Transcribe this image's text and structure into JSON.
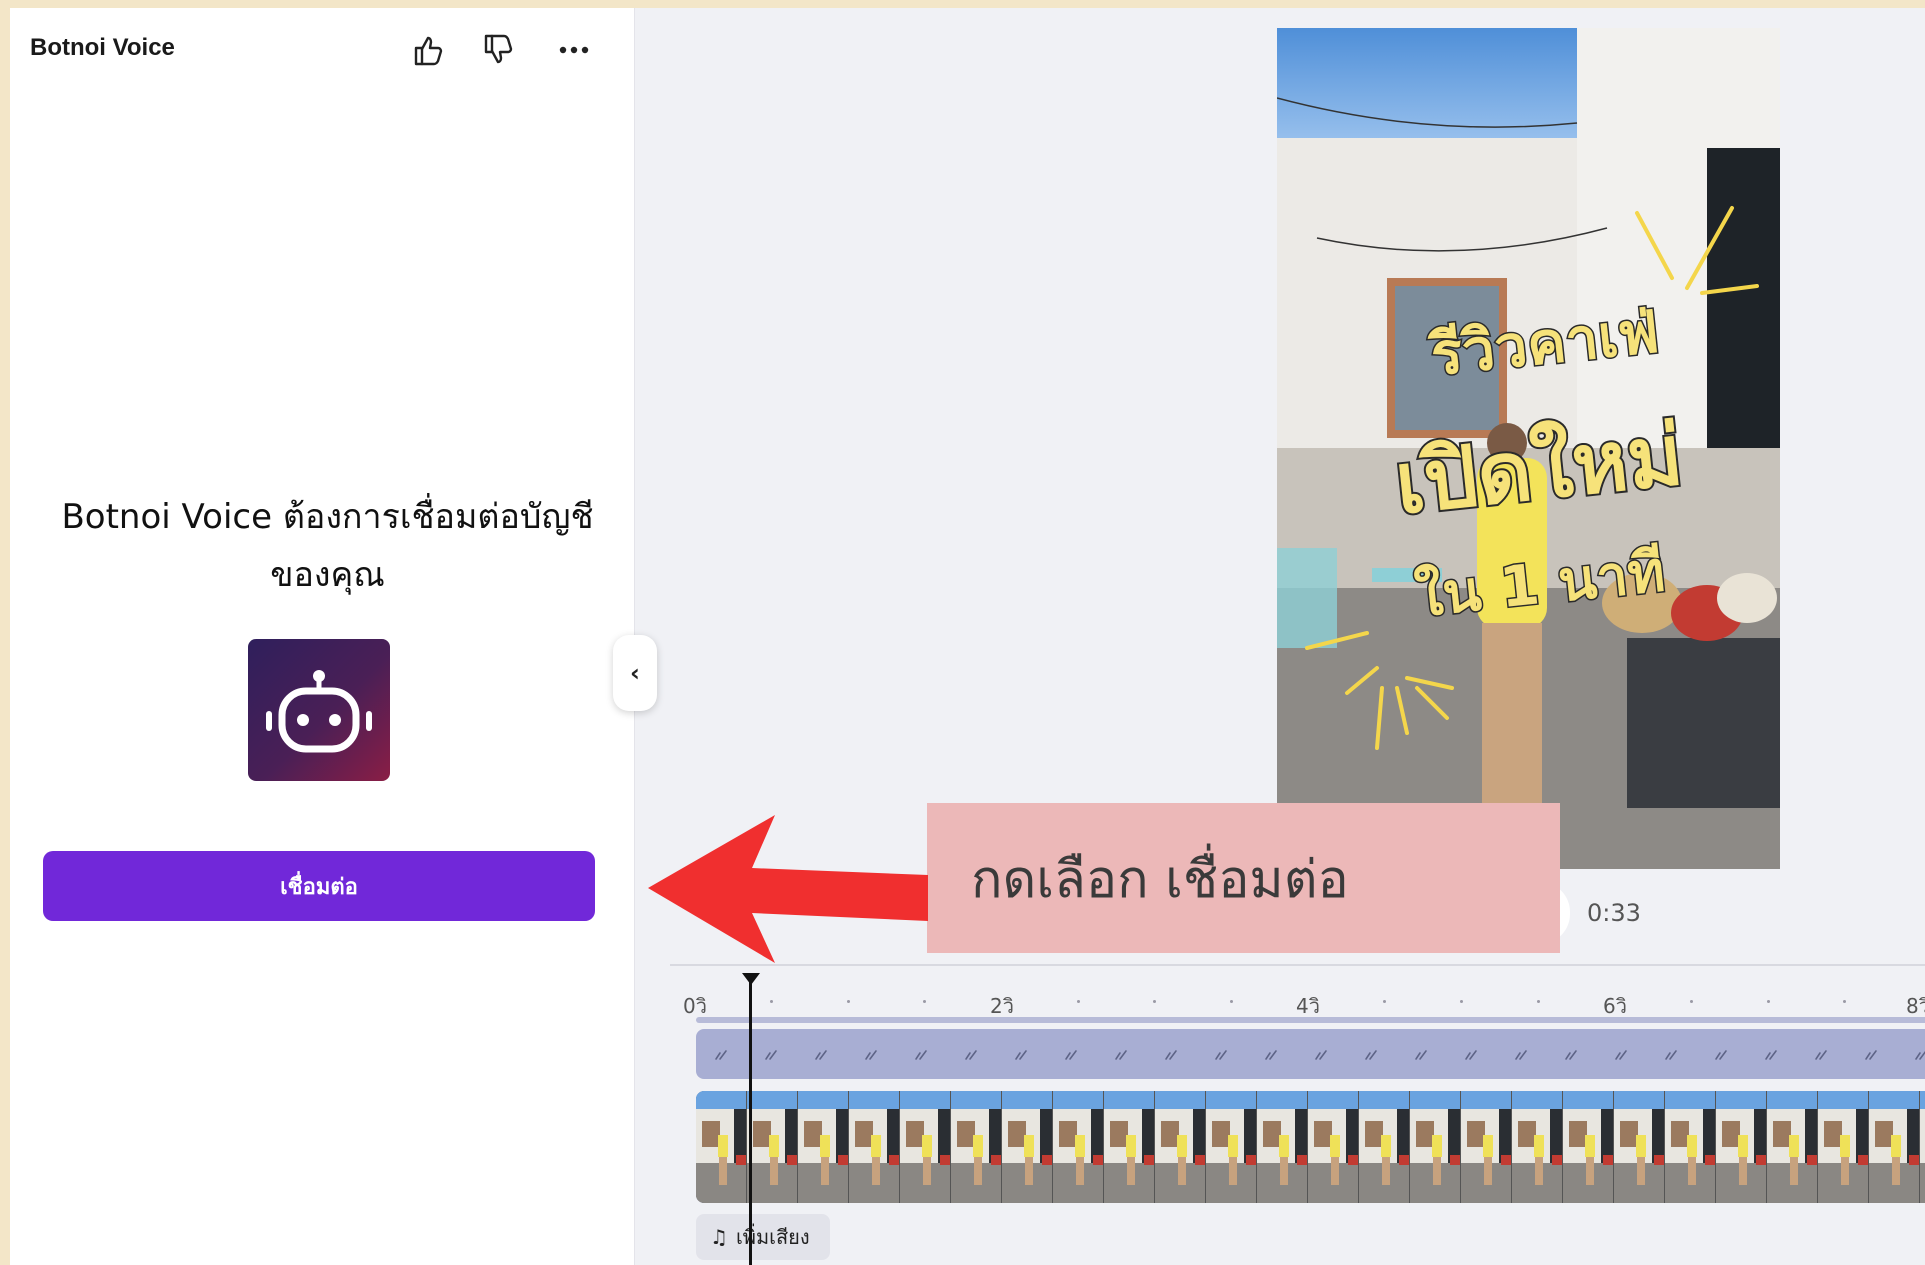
{
  "panel": {
    "title": "Botnoi Voice",
    "icons": {
      "like": "thumbs-up-icon",
      "dislike": "thumbs-down-icon",
      "more": "more-horizontal-icon"
    },
    "heading": "Botnoi Voice ต้องการเชื่อมต่อบัญชีของคุณ",
    "app_logo_icon": "robot-icon",
    "connect_label": "เชื่อมต่อ",
    "collapse_icon": "chevron-left-icon",
    "accent": "#7128d9"
  },
  "preview": {
    "overlay_line1": "รีวิวคาเฟ่",
    "overlay_line2": "เปิดใหม่",
    "overlay_line3": "ใน 1 นาที",
    "duration": "0:33"
  },
  "timeline": {
    "ruler": [
      "0วิ",
      "2วิ",
      "4วิ",
      "6วิ",
      "8วิ"
    ],
    "add_audio_label": "เพิ่มเสียง",
    "add_audio_icon": "music-note-icon"
  },
  "annotation": {
    "callout_text": "กดเลือก เชื่อมต่อ",
    "arrow_color": "#f02f2f"
  }
}
